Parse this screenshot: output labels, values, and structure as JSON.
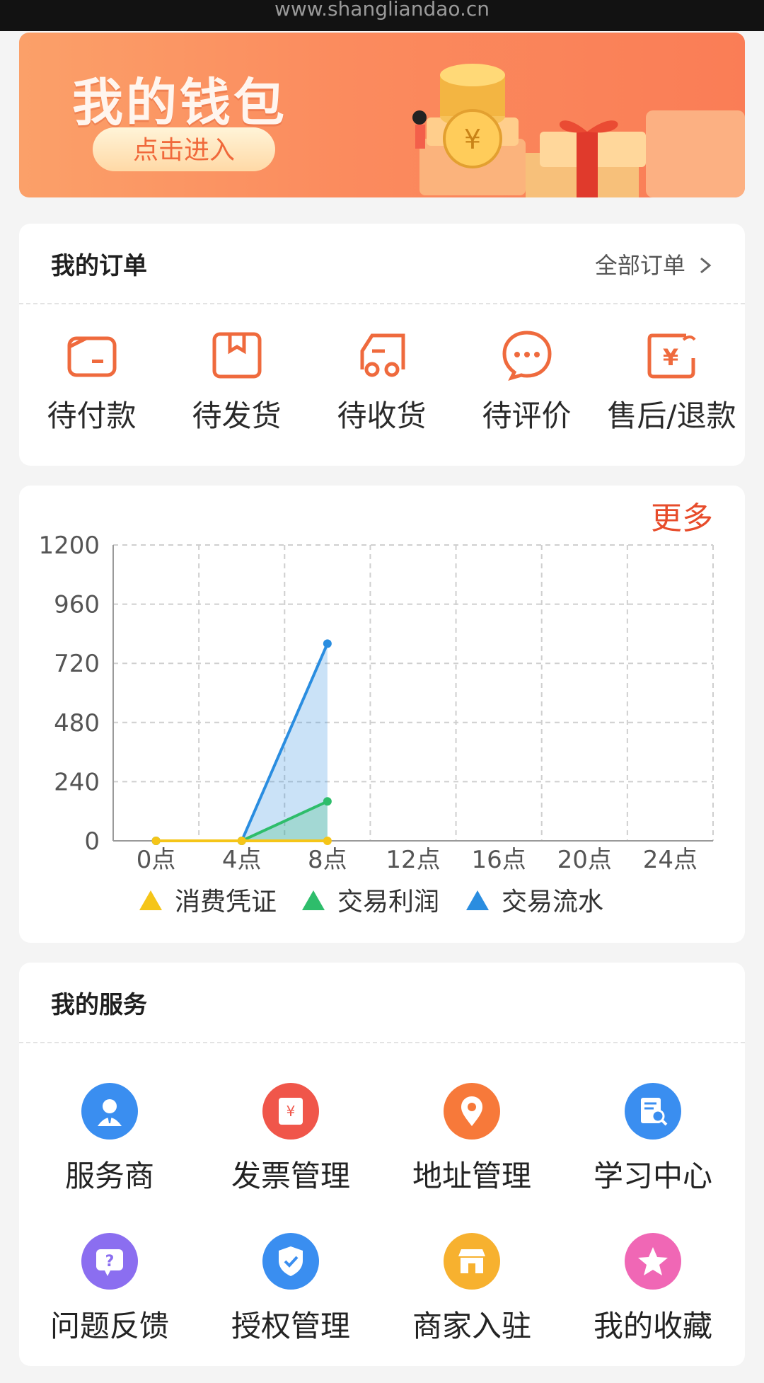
{
  "browser": {
    "url": "www.shangliandao.cn"
  },
  "wallet": {
    "title": "我的钱包",
    "button_label": "点击进入"
  },
  "orders": {
    "title": "我的订单",
    "all_label": "全部订单",
    "items": [
      {
        "label": "待付款",
        "icon": "wallet-icon"
      },
      {
        "label": "待发货",
        "icon": "box-icon"
      },
      {
        "label": "待收货",
        "icon": "truck-icon"
      },
      {
        "label": "待评价",
        "icon": "chat-icon"
      },
      {
        "label": "售后/退款",
        "icon": "refund-icon"
      }
    ]
  },
  "stats": {
    "more_label": "更多"
  },
  "chart_data": {
    "type": "line",
    "categories": [
      "0点",
      "4点",
      "8点",
      "12点",
      "16点",
      "20点",
      "24点"
    ],
    "y_ticks": [
      "1200",
      "960",
      "720",
      "480",
      "240",
      "0"
    ],
    "ylim": [
      0,
      1200
    ],
    "grid": true,
    "legend_position": "bottom",
    "series": [
      {
        "name": "消费凭证",
        "color": "#f5c518",
        "values": [
          0,
          0,
          0
        ]
      },
      {
        "name": "交易利润",
        "color": "#2ebd6b",
        "values": [
          0,
          0,
          160
        ]
      },
      {
        "name": "交易流水",
        "color": "#2a8de0",
        "values": [
          0,
          0,
          800
        ]
      }
    ]
  },
  "services": {
    "title": "我的服务",
    "items": [
      {
        "label": "服务商",
        "icon": "person-icon",
        "color": "#3a8ef0"
      },
      {
        "label": "发票管理",
        "icon": "invoice-icon",
        "color": "#f0564a"
      },
      {
        "label": "地址管理",
        "icon": "location-icon",
        "color": "#f7793a"
      },
      {
        "label": "学习中心",
        "icon": "document-search-icon",
        "color": "#3a8ef0"
      },
      {
        "label": "问题反馈",
        "icon": "question-icon",
        "color": "#8b6ef0"
      },
      {
        "label": "授权管理",
        "icon": "shield-check-icon",
        "color": "#3a8ef0"
      },
      {
        "label": "商家入驻",
        "icon": "store-icon",
        "color": "#f7b12f"
      },
      {
        "label": "我的收藏",
        "icon": "star-icon",
        "color": "#f067b5"
      }
    ]
  }
}
